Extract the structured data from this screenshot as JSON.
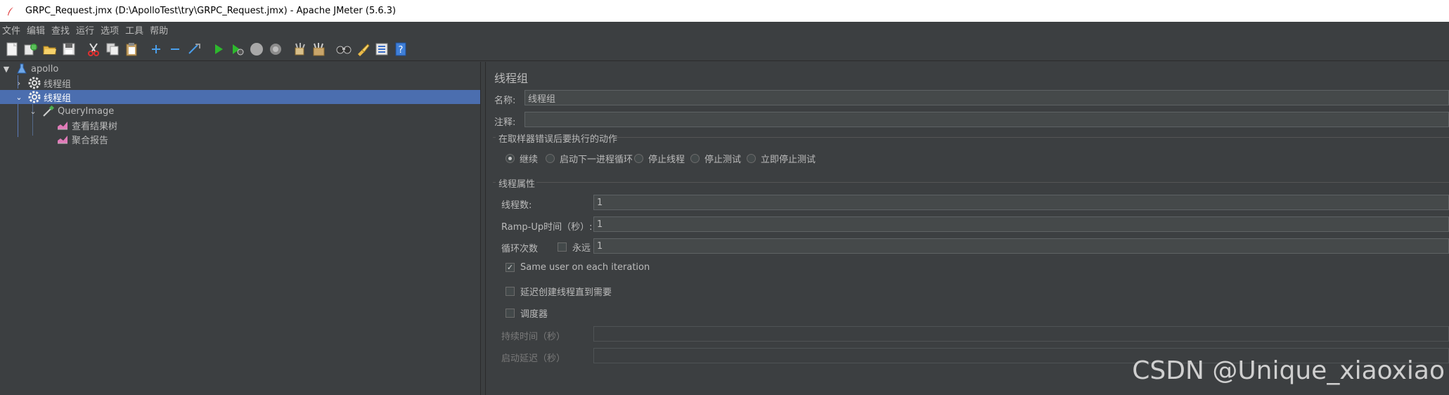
{
  "window": {
    "title": "GRPC_Request.jmx (D:\\ApolloTest\\try\\GRPC_Request.jmx) - Apache JMeter (5.6.3)"
  },
  "menu": [
    "文件",
    "编辑",
    "查找",
    "运行",
    "选项",
    "工具",
    "帮助"
  ],
  "toolbar": {
    "icons": [
      "new-icon",
      "templates-icon",
      "open-icon",
      "save-icon",
      "cut-icon",
      "copy-icon",
      "paste-icon",
      "expand-icon",
      "collapse-icon",
      "toggle-icon",
      "start-icon",
      "start-no-pause-icon",
      "stop-icon",
      "shutdown-icon",
      "clear-icon",
      "clear-all-icon",
      "search-icon",
      "reset-search-icon",
      "function-helper-icon",
      "help-icon"
    ]
  },
  "tree": {
    "root": "apollo",
    "thread_group_1": "线程组",
    "thread_group_2": "线程组",
    "sampler": "QueryImage",
    "listener_1": "查看结果树",
    "listener_2": "聚合报告"
  },
  "panel": {
    "title": "线程组",
    "name_label": "名称:",
    "name_value": "线程组",
    "comment_label": "注释:",
    "comment_value": "",
    "error_action_group": "在取样器错误后要执行的动作",
    "error_actions": [
      "继续",
      "启动下一进程循环",
      "停止线程",
      "停止测试",
      "立即停止测试"
    ],
    "error_action_selected": 0,
    "thread_props_group": "线程属性",
    "threads_label": "线程数:",
    "threads_value": "1",
    "rampup_label": "Ramp-Up时间（秒）:",
    "rampup_value": "1",
    "loop_label": "循环次数",
    "forever_label": "永远",
    "forever_checked": false,
    "loop_value": "1",
    "same_user_label": "Same user on each iteration",
    "same_user_checked": true,
    "delay_create_label": "延迟创建线程直到需要",
    "delay_create_checked": false,
    "scheduler_label": "调度器",
    "scheduler_checked": false,
    "duration_label": "持续时间（秒）",
    "duration_value": "",
    "startup_delay_label": "启动延迟（秒）",
    "startup_delay_value": ""
  },
  "watermark": "CSDN @Unique_xiaoxiao"
}
